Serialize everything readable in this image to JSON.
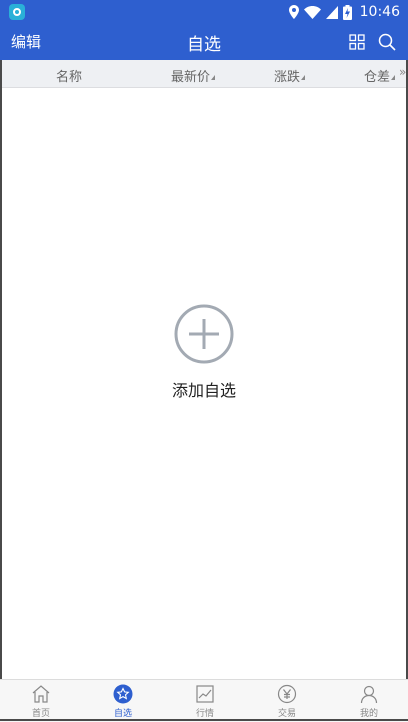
{
  "status_bar": {
    "time": "10:46",
    "icons": [
      "location-icon",
      "wifi-icon",
      "signal-icon",
      "battery-charging-icon"
    ]
  },
  "header": {
    "edit_label": "编辑",
    "title": "自选",
    "icons": [
      "grid-icon",
      "search-icon"
    ]
  },
  "columns": {
    "name": "名称",
    "latest_price": "最新价",
    "change": "涨跌",
    "open_interest_diff": "仓差",
    "more": "»"
  },
  "empty_state": {
    "action_label": "添加自选",
    "icon": "plus-circle-icon"
  },
  "tabs": [
    {
      "label": "首页",
      "icon": "home-icon",
      "active": false
    },
    {
      "label": "自选",
      "icon": "star-icon",
      "active": true
    },
    {
      "label": "行情",
      "icon": "chart-icon",
      "active": false
    },
    {
      "label": "交易",
      "icon": "yen-icon",
      "active": false
    },
    {
      "label": "我的",
      "icon": "user-icon",
      "active": false
    }
  ],
  "colors": {
    "brand": "#2e5fcf",
    "tab_inactive": "#888888",
    "header_bg": "#eef0f3"
  }
}
